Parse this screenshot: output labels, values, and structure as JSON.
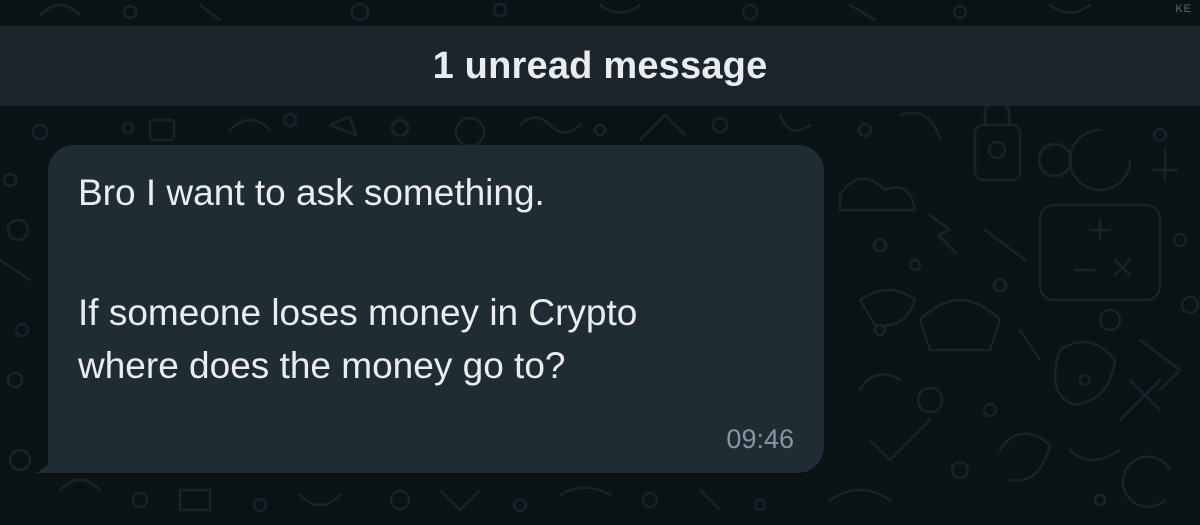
{
  "watermark": "KE",
  "banner": {
    "unread_label": "1 unread message"
  },
  "message": {
    "lines": [
      "Bro I want to ask something.",
      "If someone loses money in Crypto",
      "where does the money go to?"
    ],
    "time": "09:46"
  },
  "colors": {
    "background": "#0c1317",
    "banner": "#1d252c",
    "bubble": "#202c33",
    "text": "#e9edef",
    "time": "#8696a0"
  }
}
